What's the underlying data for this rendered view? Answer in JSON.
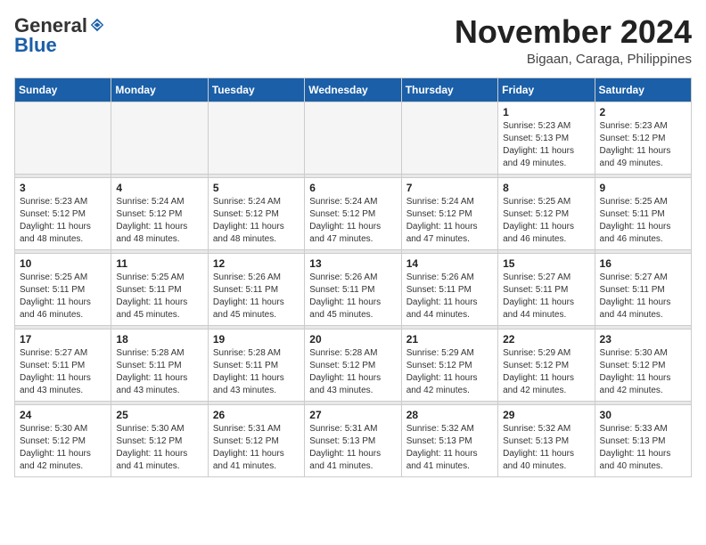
{
  "header": {
    "logo_general": "General",
    "logo_blue": "Blue",
    "month_title": "November 2024",
    "subtitle": "Bigaan, Caraga, Philippines"
  },
  "days_of_week": [
    "Sunday",
    "Monday",
    "Tuesday",
    "Wednesday",
    "Thursday",
    "Friday",
    "Saturday"
  ],
  "weeks": [
    [
      {
        "day": "",
        "info": ""
      },
      {
        "day": "",
        "info": ""
      },
      {
        "day": "",
        "info": ""
      },
      {
        "day": "",
        "info": ""
      },
      {
        "day": "",
        "info": ""
      },
      {
        "day": "1",
        "info": "Sunrise: 5:23 AM\nSunset: 5:13 PM\nDaylight: 11 hours and 49 minutes."
      },
      {
        "day": "2",
        "info": "Sunrise: 5:23 AM\nSunset: 5:12 PM\nDaylight: 11 hours and 49 minutes."
      }
    ],
    [
      {
        "day": "3",
        "info": "Sunrise: 5:23 AM\nSunset: 5:12 PM\nDaylight: 11 hours and 48 minutes."
      },
      {
        "day": "4",
        "info": "Sunrise: 5:24 AM\nSunset: 5:12 PM\nDaylight: 11 hours and 48 minutes."
      },
      {
        "day": "5",
        "info": "Sunrise: 5:24 AM\nSunset: 5:12 PM\nDaylight: 11 hours and 48 minutes."
      },
      {
        "day": "6",
        "info": "Sunrise: 5:24 AM\nSunset: 5:12 PM\nDaylight: 11 hours and 47 minutes."
      },
      {
        "day": "7",
        "info": "Sunrise: 5:24 AM\nSunset: 5:12 PM\nDaylight: 11 hours and 47 minutes."
      },
      {
        "day": "8",
        "info": "Sunrise: 5:25 AM\nSunset: 5:12 PM\nDaylight: 11 hours and 46 minutes."
      },
      {
        "day": "9",
        "info": "Sunrise: 5:25 AM\nSunset: 5:11 PM\nDaylight: 11 hours and 46 minutes."
      }
    ],
    [
      {
        "day": "10",
        "info": "Sunrise: 5:25 AM\nSunset: 5:11 PM\nDaylight: 11 hours and 46 minutes."
      },
      {
        "day": "11",
        "info": "Sunrise: 5:25 AM\nSunset: 5:11 PM\nDaylight: 11 hours and 45 minutes."
      },
      {
        "day": "12",
        "info": "Sunrise: 5:26 AM\nSunset: 5:11 PM\nDaylight: 11 hours and 45 minutes."
      },
      {
        "day": "13",
        "info": "Sunrise: 5:26 AM\nSunset: 5:11 PM\nDaylight: 11 hours and 45 minutes."
      },
      {
        "day": "14",
        "info": "Sunrise: 5:26 AM\nSunset: 5:11 PM\nDaylight: 11 hours and 44 minutes."
      },
      {
        "day": "15",
        "info": "Sunrise: 5:27 AM\nSunset: 5:11 PM\nDaylight: 11 hours and 44 minutes."
      },
      {
        "day": "16",
        "info": "Sunrise: 5:27 AM\nSunset: 5:11 PM\nDaylight: 11 hours and 44 minutes."
      }
    ],
    [
      {
        "day": "17",
        "info": "Sunrise: 5:27 AM\nSunset: 5:11 PM\nDaylight: 11 hours and 43 minutes."
      },
      {
        "day": "18",
        "info": "Sunrise: 5:28 AM\nSunset: 5:11 PM\nDaylight: 11 hours and 43 minutes."
      },
      {
        "day": "19",
        "info": "Sunrise: 5:28 AM\nSunset: 5:11 PM\nDaylight: 11 hours and 43 minutes."
      },
      {
        "day": "20",
        "info": "Sunrise: 5:28 AM\nSunset: 5:12 PM\nDaylight: 11 hours and 43 minutes."
      },
      {
        "day": "21",
        "info": "Sunrise: 5:29 AM\nSunset: 5:12 PM\nDaylight: 11 hours and 42 minutes."
      },
      {
        "day": "22",
        "info": "Sunrise: 5:29 AM\nSunset: 5:12 PM\nDaylight: 11 hours and 42 minutes."
      },
      {
        "day": "23",
        "info": "Sunrise: 5:30 AM\nSunset: 5:12 PM\nDaylight: 11 hours and 42 minutes."
      }
    ],
    [
      {
        "day": "24",
        "info": "Sunrise: 5:30 AM\nSunset: 5:12 PM\nDaylight: 11 hours and 42 minutes."
      },
      {
        "day": "25",
        "info": "Sunrise: 5:30 AM\nSunset: 5:12 PM\nDaylight: 11 hours and 41 minutes."
      },
      {
        "day": "26",
        "info": "Sunrise: 5:31 AM\nSunset: 5:12 PM\nDaylight: 11 hours and 41 minutes."
      },
      {
        "day": "27",
        "info": "Sunrise: 5:31 AM\nSunset: 5:13 PM\nDaylight: 11 hours and 41 minutes."
      },
      {
        "day": "28",
        "info": "Sunrise: 5:32 AM\nSunset: 5:13 PM\nDaylight: 11 hours and 41 minutes."
      },
      {
        "day": "29",
        "info": "Sunrise: 5:32 AM\nSunset: 5:13 PM\nDaylight: 11 hours and 40 minutes."
      },
      {
        "day": "30",
        "info": "Sunrise: 5:33 AM\nSunset: 5:13 PM\nDaylight: 11 hours and 40 minutes."
      }
    ]
  ]
}
